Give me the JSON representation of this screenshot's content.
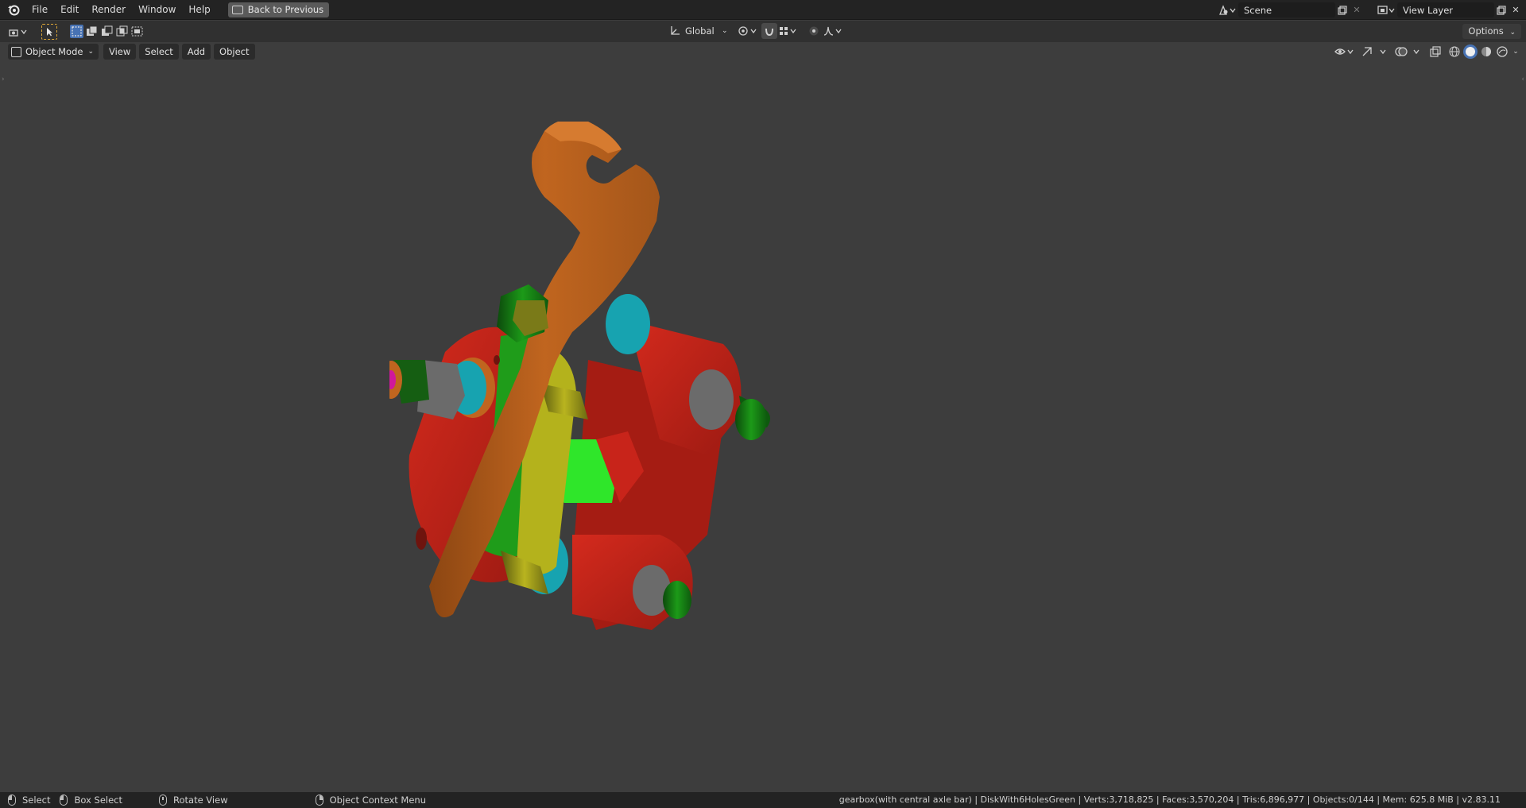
{
  "menu": {
    "file": "File",
    "edit": "Edit",
    "render": "Render",
    "window": "Window",
    "help": "Help",
    "back_to_previous": "Back to Previous"
  },
  "workspace": {
    "scene_name": "Scene",
    "view_layer_name": "View Layer"
  },
  "tool_settings": {
    "orientation": "Global",
    "options_label": "Options"
  },
  "viewport_header": {
    "mode": "Object Mode",
    "view": "View",
    "select": "Select",
    "add": "Add",
    "object": "Object"
  },
  "statusbar": {
    "select": "Select",
    "box_select": "Box Select",
    "rotate_view": "Rotate View",
    "context_menu": "Object Context Menu",
    "stats": "gearbox(with central axle bar) | DiskWith6HolesGreen | Verts:3,718,825 | Faces:3,570,204 | Tris:6,896,977 | Objects:0/144 | Mem: 625.8 MiB | v2.83.11"
  },
  "colors": {
    "accent": "#4772b3",
    "part_orange": "#c0651f",
    "part_red": "#c8241a",
    "part_green": "#1f9c1a",
    "part_yellow": "#b4b21c",
    "part_cyan": "#17a3b0",
    "part_magenta": "#d0189c",
    "bright_green": "#2fe62a"
  }
}
